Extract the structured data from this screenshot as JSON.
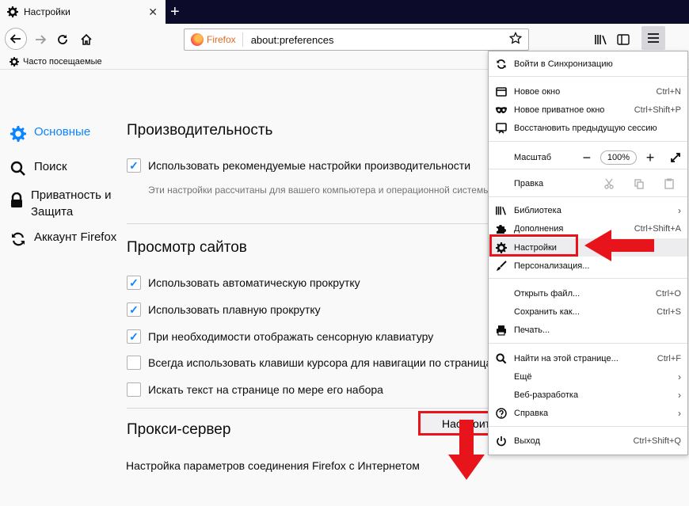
{
  "tab": {
    "title": "Настройки",
    "close": "✕",
    "newtab": "+"
  },
  "nav": {
    "brand": "Firefox",
    "url": "about:preferences"
  },
  "bookmarks": {
    "label": "Часто посещаемые"
  },
  "categories": [
    {
      "label": "Основные",
      "icon": "gear-icon"
    },
    {
      "label": "Поиск",
      "icon": "search-icon"
    },
    {
      "label": "Приватность и Защита",
      "icon": "lock-icon"
    },
    {
      "label": "Аккаунт Firefox",
      "icon": "sync-icon"
    }
  ],
  "performance": {
    "heading": "Производительность",
    "recommended": "Использовать рекомендуемые настройки производительности",
    "recommended_checked": true,
    "desc": "Эти настройки рассчитаны для вашего компьютера и операционной системы"
  },
  "browsing": {
    "heading": "Просмотр сайтов",
    "items": [
      {
        "label": "Использовать автоматическую прокрутку",
        "checked": true
      },
      {
        "label": "Использовать плавную прокрутку",
        "checked": true
      },
      {
        "label": "При необходимости отображать сенсорную клавиатуру",
        "checked": true
      },
      {
        "label": "Всегда использовать клавиши курсора для навигации по страницам",
        "checked": false
      },
      {
        "label": "Искать текст на странице по мере его набора",
        "checked": false
      }
    ]
  },
  "proxy": {
    "heading": "Прокси-сервер",
    "desc": "Настройка параметров соединения Firefox с Интернетом",
    "button": "Настроить..."
  },
  "menu": {
    "sync": "Войти в Синхронизацию",
    "new_window": "Новое окно",
    "new_window_sc": "Ctrl+N",
    "private": "Новое приватное окно",
    "private_sc": "Ctrl+Shift+P",
    "restore": "Восстановить предыдущую сессию",
    "zoom_label": "Масштаб",
    "zoom_minus": "−",
    "zoom_value": "100%",
    "zoom_plus": "+",
    "edit_label": "Правка",
    "library": "Библиотека",
    "addons": "Дополнения",
    "addons_sc": "Ctrl+Shift+A",
    "settings": "Настройки",
    "customize": "Персонализация...",
    "open_file": "Открыть файл...",
    "open_file_sc": "Ctrl+O",
    "save_as": "Сохранить как...",
    "save_as_sc": "Ctrl+S",
    "print": "Печать...",
    "find": "Найти на этой странице...",
    "find_sc": "Ctrl+F",
    "more": "Ещё",
    "webdev": "Веб-разработка",
    "help": "Справка",
    "exit": "Выход",
    "exit_sc": "Ctrl+Shift+Q",
    "arrow": "›"
  },
  "colors": {
    "accent": "#0a84ff",
    "highlight": "#e8141b",
    "tabbar": "#0c0c2a"
  }
}
